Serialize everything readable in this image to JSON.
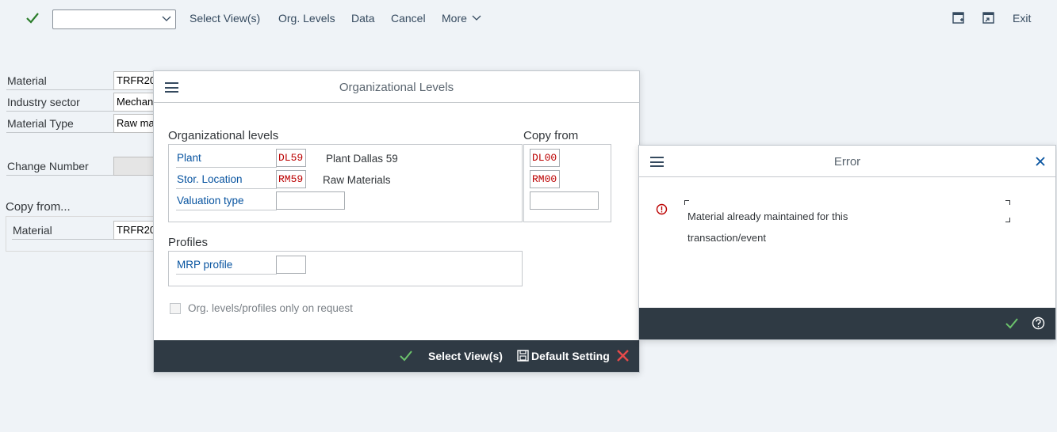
{
  "toolbar": {
    "select_value": "",
    "items": [
      "Select View(s)",
      "Org. Levels",
      "Data",
      "Cancel",
      "More"
    ],
    "exit": "Exit"
  },
  "background_form": {
    "material_label": "Material",
    "material_value": "TRFR20",
    "industry_label": "Industry sector",
    "industry_value": "Mechan",
    "type_label": "Material Type",
    "type_value": "Raw ma",
    "change_label": "Change Number",
    "change_value": "",
    "copy_title": "Copy from...",
    "copy_material_label": "Material",
    "copy_material_value": "TRFR20"
  },
  "org_dialog": {
    "title": "Organizational Levels",
    "org_levels_title": "Organizational levels",
    "copy_from_title": "Copy from",
    "plant_label": "Plant",
    "plant_value": "DL59",
    "plant_desc": "Plant Dallas 59",
    "stor_label": "Stor. Location",
    "stor_value": "RM59",
    "stor_desc": "Raw Materials",
    "val_label": "Valuation type",
    "val_value": "",
    "copy_plant": "DL00",
    "copy_stor": "RM00",
    "copy_val": "",
    "profiles_title": "Profiles",
    "mrp_label": "MRP profile",
    "mrp_value": "",
    "checkbox_label": "Org. levels/profiles only on request",
    "footer_select": "Select View(s)",
    "footer_default": "Default Setting"
  },
  "error_dialog": {
    "title": "Error",
    "message_line1": "Material already maintained for this",
    "message_line2": "transaction/event"
  },
  "colors": {
    "footer_bg": "#2f3a44",
    "link": "#0854a0",
    "error": "#bb0000",
    "success": "#2b7d2b"
  }
}
